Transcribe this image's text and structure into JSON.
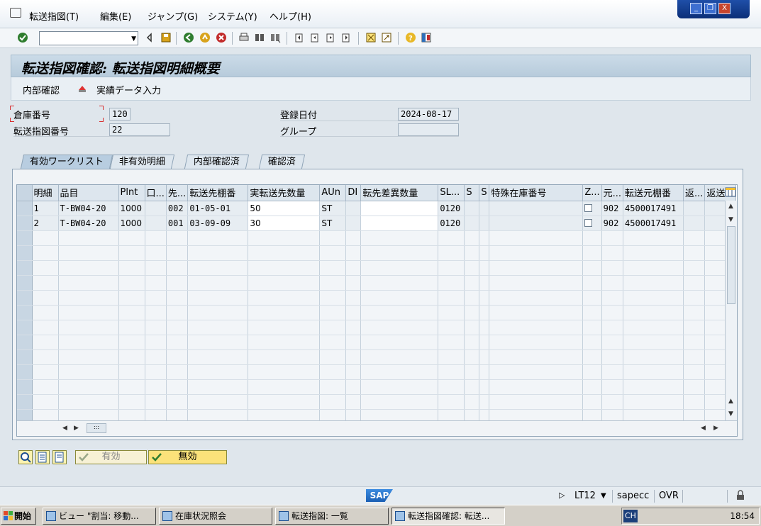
{
  "menu": {
    "items": [
      "転送指図(T)",
      "編集(E)",
      "ジャンプ(G)",
      "システム(Y)",
      "ヘルプ(H)"
    ]
  },
  "window_buttons": {
    "minimize": "_",
    "restore": "❐",
    "close": "X"
  },
  "toolbar": {
    "command_field_value": "",
    "icons": [
      "enter-icon",
      "save-icon",
      "back-icon",
      "exit-icon",
      "cancel-icon",
      "print-icon",
      "find-icon",
      "find-next-icon",
      "first-page-icon",
      "prev-page-icon",
      "next-page-icon",
      "last-page-icon",
      "new-session-icon",
      "shortcut-icon",
      "help-icon",
      "layout-icon"
    ]
  },
  "title": "転送指図確認: 転送指図明細概要",
  "app_toolbar": {
    "internal_confirm": "内部確認",
    "actual_data_entry": "実績データ入力"
  },
  "header": {
    "warehouse_label": "倉庫番号",
    "warehouse_value": "120",
    "to_number_label": "転送指図番号",
    "to_number_value": "22",
    "created_date_label": "登録日付",
    "created_date_value": "2024-08-17",
    "group_label": "グループ",
    "group_value": ""
  },
  "tabs": [
    {
      "label": "有効ワークリスト",
      "active": true
    },
    {
      "label": "非有効明細",
      "active": false
    },
    {
      "label": "内部確認済",
      "active": false
    },
    {
      "label": "確認済",
      "active": false
    }
  ],
  "table": {
    "columns": [
      "明細",
      "品目",
      "Plnt",
      "口...",
      "先...",
      "転送先棚番",
      "実転送先数量",
      "AUn",
      "DI",
      "転先差異数量",
      "SL...",
      "S",
      "S",
      "特殊在庫番号",
      "Z...",
      "元...",
      "転送元棚番",
      "返...",
      "返送..."
    ],
    "rows": [
      [
        "1",
        "T-BW04-20",
        "1000",
        "",
        "002",
        "01-05-01",
        "50",
        "ST",
        "",
        "",
        "0120",
        "",
        "",
        "",
        "",
        "902",
        "4500017491",
        "",
        ""
      ],
      [
        "2",
        "T-BW04-20",
        "1000",
        "",
        "001",
        "03-09-09",
        "30",
        "ST",
        "",
        "",
        "0120",
        "",
        "",
        "",
        "",
        "902",
        "4500017491",
        "",
        ""
      ]
    ],
    "empty_rows": 14
  },
  "bottom_buttons": {
    "valid": "有効",
    "invalid": "無効"
  },
  "status_bar": {
    "sap": "SAP",
    "transaction": "LT12",
    "server": "sapecc",
    "mode": "OVR"
  },
  "taskbar": {
    "start": "開始",
    "tasks": [
      {
        "label": "ビュー \"割当: 移動...",
        "active": false
      },
      {
        "label": "在庫状況照会",
        "active": false
      },
      {
        "label": "転送指図: 一覧",
        "active": false
      },
      {
        "label": "転送指図確認: 転送...",
        "active": true
      }
    ],
    "clock": "18:54",
    "tray_lang": "CH"
  },
  "colors": {
    "title_bg": "#b7cbdb",
    "button_yellow": "#fdf3b0",
    "button_invalid": "#fbe27a",
    "window_blue": "#0b2f78"
  }
}
